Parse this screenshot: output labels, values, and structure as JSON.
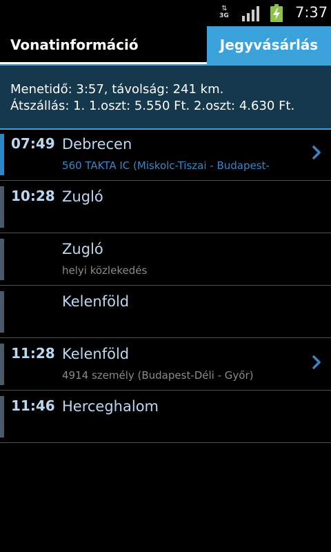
{
  "statusbar": {
    "network_label": "3G",
    "time": "7:37",
    "icons": [
      "data-activity-icon",
      "signal-icon",
      "battery-charging-icon"
    ]
  },
  "tabs": {
    "info_label": "Vonatinformáció",
    "buy_label": "Jegyvásárlás"
  },
  "summary": {
    "line1": "Menetidő: 3:57, távolság: 241 km.",
    "line2": "Átszállás: 1. 1.oszt: 5.550 Ft. 2.oszt: 4.630 Ft."
  },
  "colors": {
    "accent": "#3aa1db",
    "summary_bg": "#16384d",
    "text_light": "#bcd8f0",
    "train_link": "#3a86c4",
    "muted": "#8a8a8a"
  },
  "rows": [
    {
      "time": "07:49",
      "station": "Debrecen",
      "sub": "560 TAKTA IC (Miskolc-Tiszai - Budapest-",
      "chevron": true
    },
    {
      "time": "10:28",
      "station": "Zugló",
      "sub": "",
      "chevron": false
    },
    {
      "time": "",
      "station": "Zugló",
      "sub": "helyi közlekedés",
      "chevron": false
    },
    {
      "time": "",
      "station": "Kelenföld",
      "sub": "",
      "chevron": false
    },
    {
      "time": "11:28",
      "station": "Kelenföld",
      "sub": "4914 személy (Budapest-Déli - Győr)",
      "chevron": true
    },
    {
      "time": "11:46",
      "station": "Herceghalom",
      "sub": "",
      "chevron": false
    }
  ]
}
